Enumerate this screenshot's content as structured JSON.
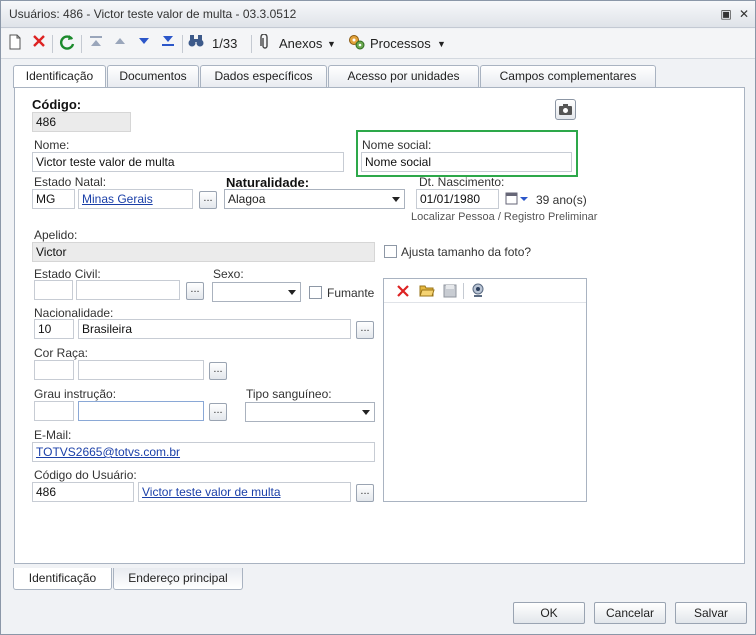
{
  "window": {
    "title": "Usuários: 486 - Victor teste valor de multa - 03.3.0512",
    "pin_glyph": "▣",
    "close_glyph": "✕"
  },
  "toolbar": {
    "record_counter": "1/33",
    "attachments_label": "Anexos",
    "processes_label": "Processos",
    "dropdown_glyph": "▼"
  },
  "tabs": [
    {
      "label": "Identificação",
      "active": true
    },
    {
      "label": "Documentos"
    },
    {
      "label": "Dados específicos"
    },
    {
      "label": "Acesso por unidades"
    },
    {
      "label": "Campos complementares"
    }
  ],
  "form": {
    "codigo": {
      "label": "Código:",
      "value": "486"
    },
    "nome": {
      "label": "Nome:",
      "value": "Victor teste valor de multa"
    },
    "nome_social": {
      "label": "Nome social:",
      "value": "Nome social"
    },
    "estado_natal": {
      "label": "Estado Natal:",
      "code": "MG",
      "name": "Minas Gerais"
    },
    "naturalidade": {
      "label": "Naturalidade:",
      "value": "Alagoa"
    },
    "dt_nascimento": {
      "label": "Dt. Nascimento:",
      "value": "01/01/1980",
      "age": "39 ano(s)"
    },
    "localizar_pessoa": "Localizar Pessoa / Registro Preliminar",
    "apelido": {
      "label": "Apelido:",
      "value": "Victor"
    },
    "ajusta_foto": {
      "label": "Ajusta tamanho da foto?",
      "checked": false
    },
    "estado_civil": {
      "label": "Estado Civil:",
      "code": "",
      "name": ""
    },
    "sexo": {
      "label": "Sexo:",
      "value": ""
    },
    "fumante": {
      "label": "Fumante",
      "checked": false
    },
    "nacionalidade": {
      "label": "Nacionalidade:",
      "code": "10",
      "name": "Brasileira"
    },
    "cor_raca": {
      "label": "Cor Raça:",
      "code": "",
      "name": ""
    },
    "grau_instrucao": {
      "label": "Grau instrução:",
      "code": "",
      "name": ""
    },
    "tipo_sanguineo": {
      "label": "Tipo sanguíneo:",
      "value": ""
    },
    "email": {
      "label": "E-Mail:",
      "value": "TOTVS2665@totvs.com.br"
    },
    "codigo_usuario": {
      "label": "Código do Usuário:",
      "code": "486",
      "name": "Victor teste valor de multa"
    },
    "ellipsis": "..."
  },
  "bottom_tabs": [
    {
      "label": "Identificação",
      "active": true
    },
    {
      "label": "Endereço principal"
    }
  ],
  "buttons": {
    "ok": "OK",
    "cancel": "Cancelar",
    "save": "Salvar"
  },
  "colors": {
    "highlight": "#2da84a",
    "link": "#1a3fa8"
  }
}
